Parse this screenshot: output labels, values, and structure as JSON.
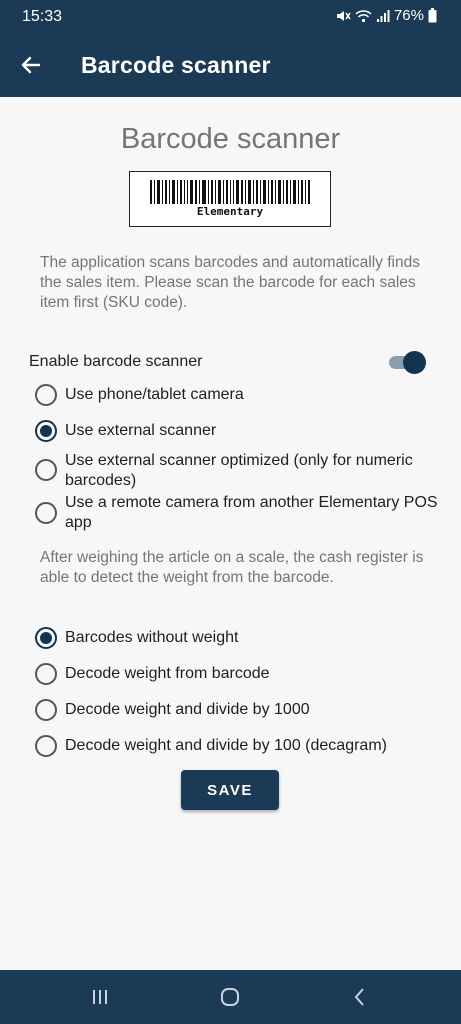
{
  "status_bar": {
    "time": "15:33",
    "battery": "76%"
  },
  "app_bar": {
    "title": "Barcode scanner"
  },
  "page": {
    "heading": "Barcode scanner",
    "barcode_caption": "Elementary",
    "description": "The application scans barcodes and automatically finds the sales item. Please scan the barcode for each sales item first (SKU code).",
    "enable_label": "Enable barcode scanner",
    "enable_on": true,
    "scanner_options": [
      {
        "label": "Use phone/tablet camera",
        "checked": false
      },
      {
        "label": "Use external scanner",
        "checked": true
      },
      {
        "label": "Use external scanner optimized (only for numeric barcodes)",
        "checked": false
      },
      {
        "label": "Use a remote camera from another Elementary POS app",
        "checked": false
      }
    ],
    "weight_description": "After weighing the article on a scale, the cash register is able to detect the weight from the barcode.",
    "weight_options": [
      {
        "label": "Barcodes without weight",
        "checked": true
      },
      {
        "label": "Decode weight from barcode",
        "checked": false
      },
      {
        "label": "Decode weight and divide by 1000",
        "checked": false
      },
      {
        "label": "Decode weight and divide by 100 (decagram)",
        "checked": false
      }
    ],
    "save_label": "SAVE"
  },
  "colors": {
    "primary": "#1b3a55",
    "accent": "#12344f",
    "background": "#f7f7f7",
    "muted_text": "#757575"
  }
}
